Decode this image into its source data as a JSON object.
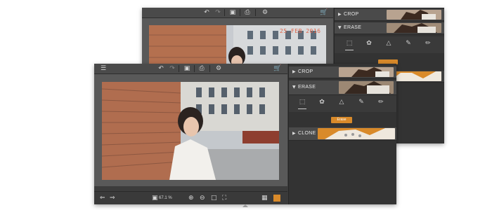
{
  "back_window": {
    "photo_date": "25 FEB 2016",
    "panel": {
      "crop_label": "CROP",
      "erase_label": "ERASE"
    }
  },
  "front_window": {
    "panel": {
      "crop_label": "CROP",
      "erase_label": "ERASE",
      "erase_button": "Erase",
      "clone_label": "CLONE"
    },
    "zoom": "67.1 %"
  },
  "colors": {
    "accent": "#d98a2a",
    "window_bg": "#3c3c3c",
    "panel_bg": "#333333"
  },
  "icons": [
    "menu-icon",
    "undo-icon",
    "redo-icon",
    "save-icon",
    "print-icon",
    "settings-icon",
    "cart-icon",
    "rect-select-icon",
    "lasso-icon",
    "polygon-lasso-icon",
    "brush-icon",
    "eraser-icon",
    "arrow-left-icon",
    "arrow-right-icon",
    "zoom-in-icon",
    "zoom-out-icon",
    "fit-icon",
    "fullscreen-icon"
  ]
}
